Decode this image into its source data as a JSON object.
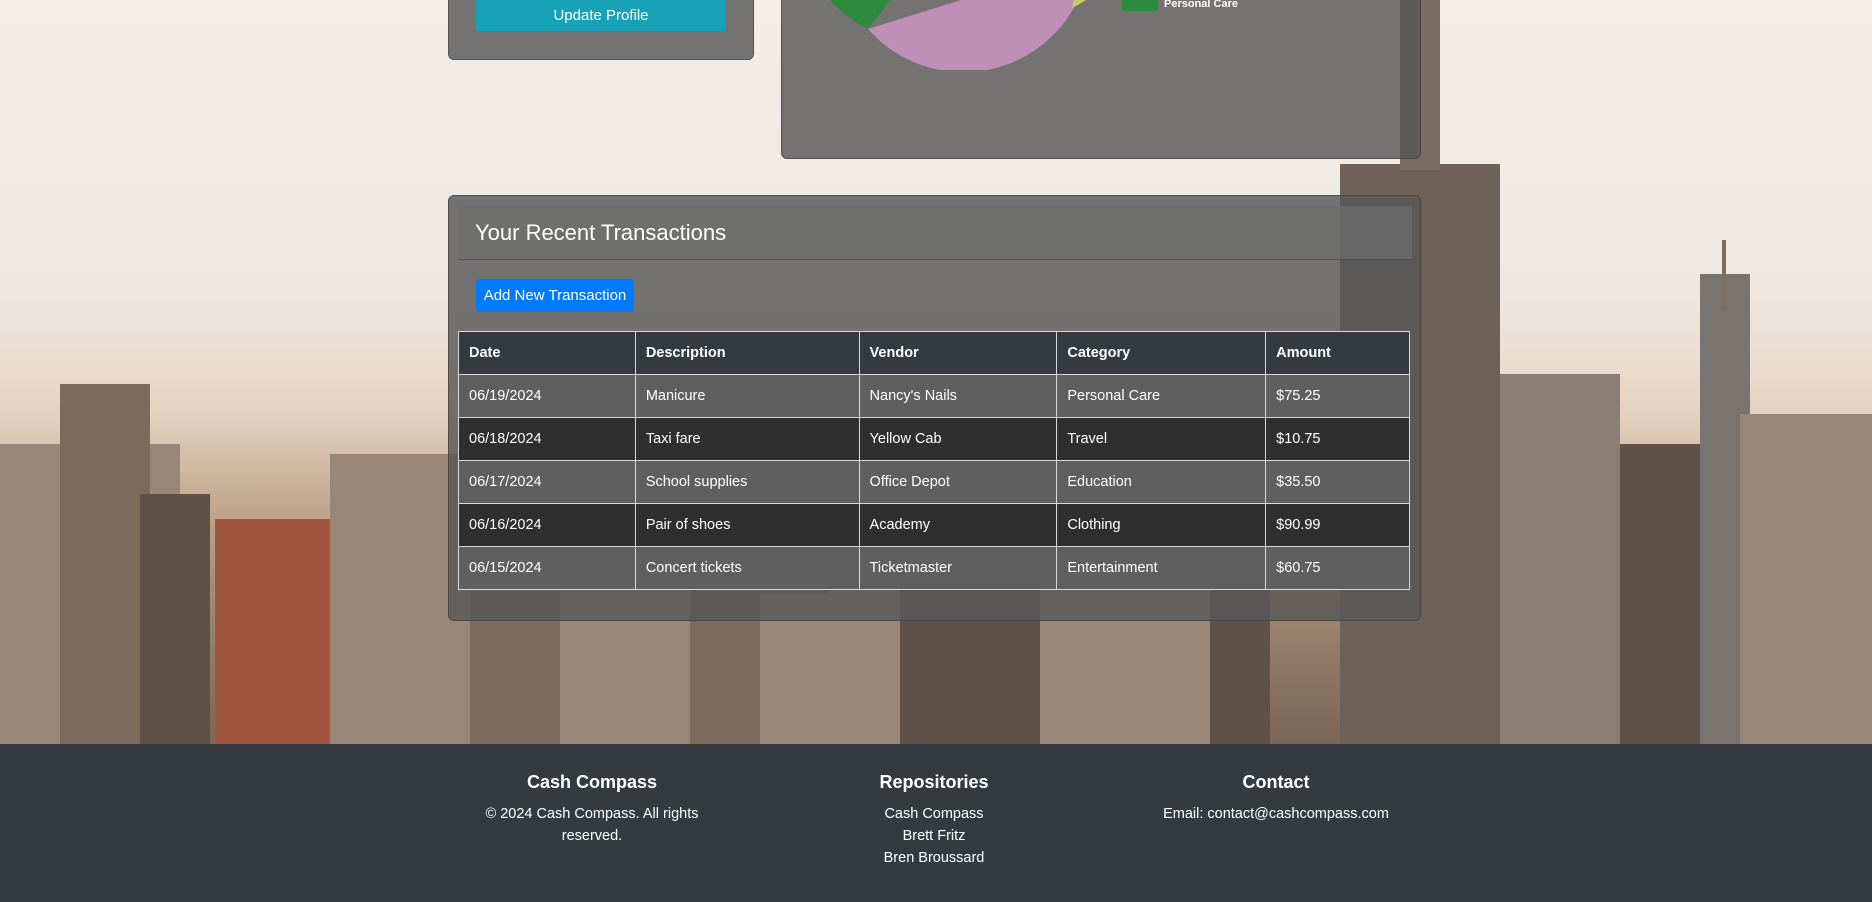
{
  "profile": {
    "update_label": "Update Profile"
  },
  "spending_chart": {
    "legend": [
      {
        "label": "Personal Care",
        "color": "#2e8b3e"
      }
    ],
    "colors": {
      "pink": "#c58db5",
      "green": "#2e8b3e",
      "yellow": "#c9cc6a"
    }
  },
  "transactions": {
    "title": "Your Recent Transactions",
    "add_label": "Add New Transaction",
    "columns": [
      "Date",
      "Description",
      "Vendor",
      "Category",
      "Amount"
    ],
    "rows": [
      [
        "06/19/2024",
        "Manicure",
        "Nancy's Nails",
        "Personal Care",
        "$75.25"
      ],
      [
        "06/18/2024",
        "Taxi fare",
        "Yellow Cab",
        "Travel",
        "$10.75"
      ],
      [
        "06/17/2024",
        "School supplies",
        "Office Depot",
        "Education",
        "$35.50"
      ],
      [
        "06/16/2024",
        "Pair of shoes",
        "Academy",
        "Clothing",
        "$90.99"
      ],
      [
        "06/15/2024",
        "Concert tickets",
        "Ticketmaster",
        "Entertainment",
        "$60.75"
      ]
    ]
  },
  "footer": {
    "brand": {
      "title": "Cash Compass",
      "copyright": "© 2024 Cash Compass. All rights reserved."
    },
    "repositories": {
      "title": "Repositories",
      "links": [
        "Cash Compass",
        "Brett Fritz",
        "Bren Broussard"
      ]
    },
    "contact": {
      "title": "Contact",
      "email_line": "Email: contact@cashcompass.com"
    }
  },
  "colors": {
    "primary": "#007bff",
    "info": "#17a2b8",
    "dark": "#343a40"
  }
}
